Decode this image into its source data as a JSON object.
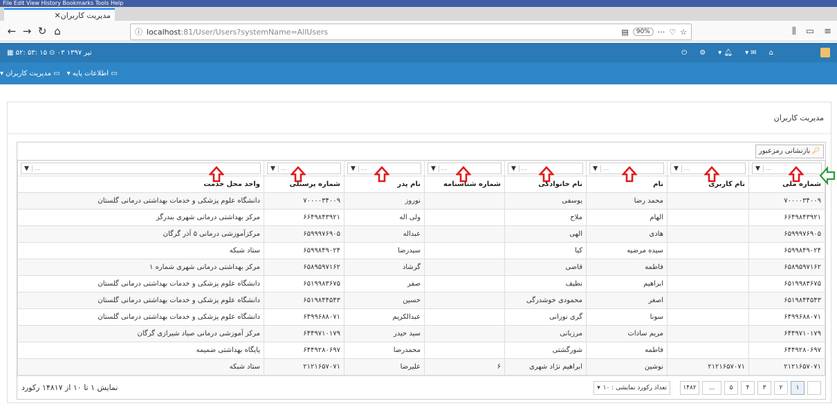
{
  "browser": {
    "menu_text": "File  Edit  View  History  Bookmarks  Tools  Help",
    "tab_title": "مدیریت کاربران",
    "url_host": "localhost",
    "url_rest": ":81/User/Users?systemName=AllUsers",
    "zoom": "90%"
  },
  "app": {
    "datetime": "۵۲: ۵۳: ۱۵ ⊙ ۰۳ تیر ۱۳۹۷",
    "menu1": "اطلاعات پایه",
    "menu2": "مدیریت کاربران",
    "page_title": "مدیریت کاربران",
    "reset_password": "بازنشانی رمزعبور",
    "accent": "#2e86c6",
    "header": "#2b79b5"
  },
  "grid": {
    "headers": [
      "شماره ملی",
      "نام کاربری",
      "نام",
      "نام خانوادگی",
      "شماره شناسنامه",
      "نام پدر",
      "شماره پرسنلی",
      "واحد محل خدمت"
    ],
    "rows": [
      [
        "۷۰۰۰۰۳۴۰۰۹",
        "",
        "محمد رضا",
        "یوسفی",
        "",
        "نوروز",
        "۷۰۰۰۰۳۴۰۰۹",
        "دانشگاه علوم پزشکی و خدمات بهداشتی درمانی گلستان"
      ],
      [
        "۶۶۴۹۸۴۳۹۲۱",
        "",
        "الهام",
        "ملاح",
        "",
        "ولی اله",
        "۶۶۴۹۸۴۳۹۲۱",
        "مرکز بهداشتی درمانی شهری بندرگز"
      ],
      [
        "۶۵۹۹۹۷۶۹۰۵",
        "",
        "هادی",
        "الهی",
        "",
        "عبداله",
        "۶۵۹۹۹۷۶۹۰۵",
        "مرکزآموزشی درمانی ۵ آذر گرگان"
      ],
      [
        "۶۵۹۹۸۴۹۰۲۴",
        "",
        "سیده مرضیه",
        "کیا",
        "",
        "سیدرضا",
        "۶۵۹۹۸۴۹۰۲۴",
        "ستاد شبکه"
      ],
      [
        "۶۵۸۹۵۹۷۱۶۲",
        "",
        "فاطمه",
        "قاضی",
        "",
        "گرشاد",
        "۶۵۸۹۵۹۷۱۶۲",
        "مرکز بهداشتی درمانی شهری شماره ۱"
      ],
      [
        "۶۵۱۹۹۸۳۶۷۵",
        "",
        "ابراهیم",
        "نظیف",
        "",
        "صفر",
        "۶۵۱۹۹۸۳۶۷۵",
        "دانشگاه علوم پزشکی و خدمات بهداشتی درمانی گلستان"
      ],
      [
        "۶۵۱۹۸۴۴۵۴۳",
        "",
        "اصغر",
        "محمودی خوشدرگی",
        "",
        "حسین",
        "۶۵۱۹۸۴۴۵۴۳",
        "دانشگاه علوم پزشکی و خدمات بهداشتی درمانی گلستان"
      ],
      [
        "۶۴۹۹۶۸۸۰۷۱",
        "",
        "سونا",
        "گری نورانی",
        "",
        "عبدالکریم",
        "۶۴۹۹۶۸۸۰۷۱",
        "دانشگاه علوم پزشکی و خدمات بهداشتی درمانی گلستان"
      ],
      [
        "۶۴۴۹۷۱۰۱۷۹",
        "",
        "مریم سادات",
        "مرزبانی",
        "",
        "سید حیدر",
        "۶۴۴۹۷۱۰۱۷۹",
        "مرکز آموزشی درمانی صیاد شیرازی گرگان"
      ],
      [
        "۶۴۴۹۲۸۰۶۹۷",
        "",
        "فاطمه",
        "شورگشتی",
        "",
        "محمدرضا",
        "۶۴۴۹۲۸۰۶۹۷",
        "پایگاه بهداشتی ضمیمه"
      ],
      [
        "۲۱۲۱۶۵۷۰۷۱",
        "۲۱۲۱۶۵۷۰۷۱",
        "نوشین",
        "ابراهیم نژاد شهری",
        "۶",
        "علیرضا",
        "۲۱۲۱۶۵۷۰۷۱",
        "ستاد شبکه"
      ]
    ],
    "pages": [
      "۱",
      "۲",
      "۳",
      "۴",
      "۵",
      "...",
      "۱۴۸۲"
    ],
    "page_size_label": "تعداد رکورد نمایشی : ۱۰",
    "summary": "نمایش ۱ تا ۱۰ از ۱۴۸۱۷ رکورد"
  }
}
